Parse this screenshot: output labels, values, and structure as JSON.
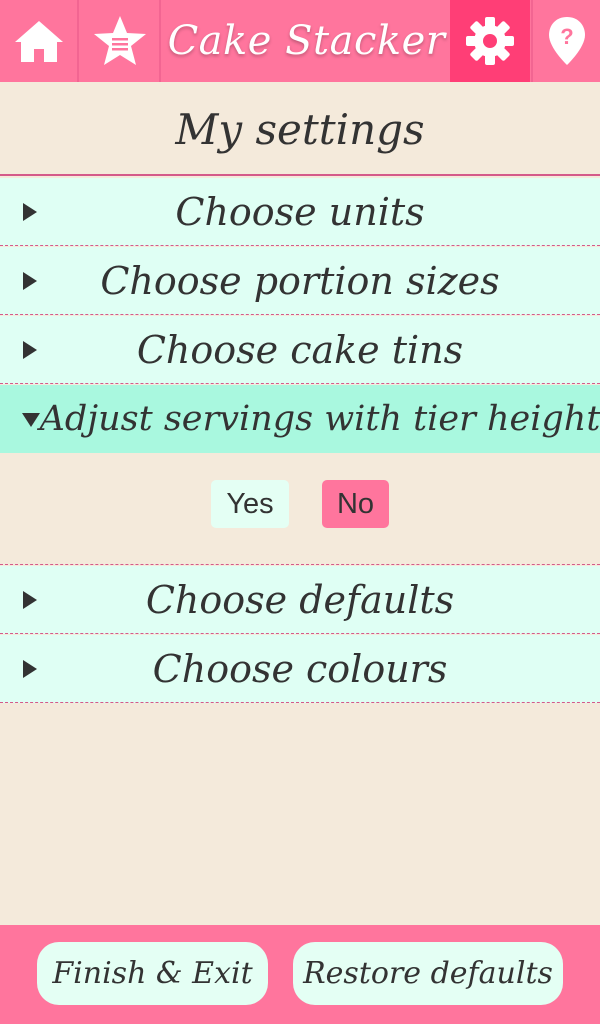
{
  "app": {
    "title": "Cake Stacker",
    "accent_color": "#ff759d",
    "active_color": "#ff3e76",
    "background_color": "#f4eadb",
    "row_color": "#dffff4",
    "expanded_row_color": "#a9f8df"
  },
  "topbar": {
    "home_icon": "home-icon",
    "favourites_icon": "star-list-icon",
    "settings_icon": "gear-icon",
    "help_icon": "help-pin-icon",
    "active_tab": "settings"
  },
  "page": {
    "title": "My settings"
  },
  "sections": [
    {
      "label": "Choose units",
      "expanded": false
    },
    {
      "label": "Choose portion sizes",
      "expanded": false
    },
    {
      "label": "Choose cake tins",
      "expanded": false
    },
    {
      "label": "Adjust servings with tier height",
      "expanded": true
    },
    {
      "label": "Choose defaults",
      "expanded": false
    },
    {
      "label": "Choose colours",
      "expanded": false
    }
  ],
  "tier_height_options": {
    "yes_label": "Yes",
    "no_label": "No",
    "selected": "No"
  },
  "footer": {
    "finish_label": "Finish & Exit",
    "restore_label": "Restore defaults"
  }
}
